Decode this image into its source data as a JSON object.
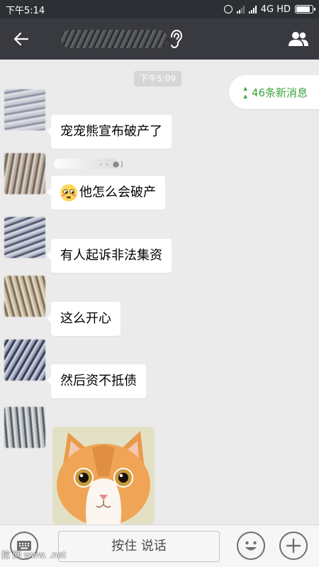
{
  "status_bar": {
    "time": "下午5:14",
    "network": "4G HD"
  },
  "header": {
    "back_icon": "arrow-left-icon",
    "listen_icon": "ear-icon",
    "group_icon": "group-members-icon"
  },
  "chat": {
    "timestamp": "下午5:09",
    "new_messages": "46条新消息",
    "sender_suffix": "- - ●)",
    "messages": [
      {
        "text": "宠宠熊宣布破产了"
      },
      {
        "emoji": "flushed-face-emoji",
        "text": "他怎么会破产"
      },
      {
        "text": "有人起诉非法集资"
      },
      {
        "text": "这么开心"
      },
      {
        "text": "然后资不抵债"
      }
    ],
    "sticker": "surprised-cat-sticker"
  },
  "input_bar": {
    "hold_to_talk": "按住 说话",
    "keyboard_icon": "keyboard-icon",
    "emoji_icon": "smiley-icon",
    "plus_icon": "plus-icon"
  },
  "watermark": "挖 网 www.    .net",
  "colors": {
    "status_bar": "#2c2f33",
    "header": "#393a3f",
    "chat_bg": "#ebebeb",
    "new_msg_green": "#3aa53a"
  }
}
